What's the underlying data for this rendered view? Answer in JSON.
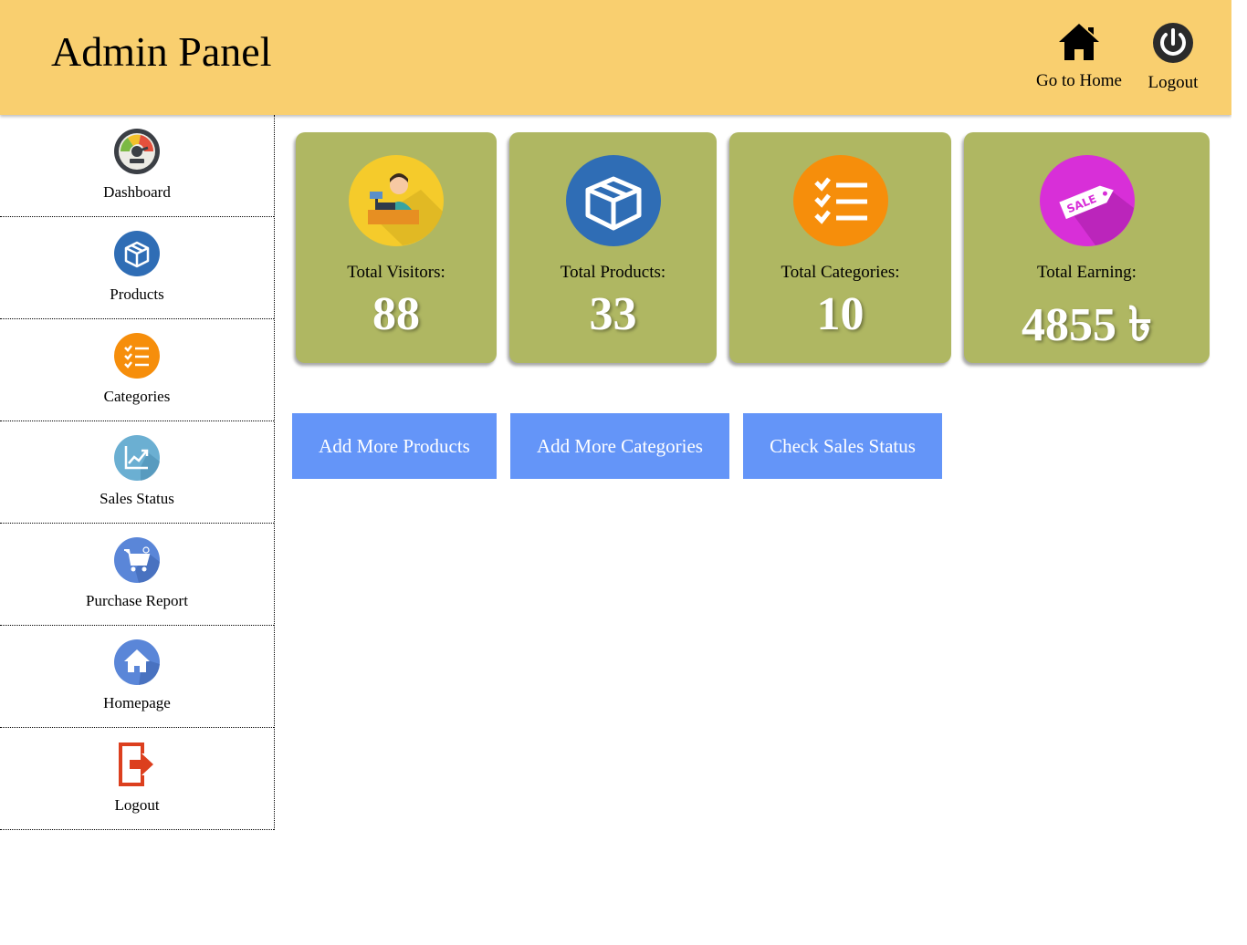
{
  "header": {
    "title": "Admin Panel",
    "home_label": "Go to Home",
    "logout_label": "Logout"
  },
  "sidebar": {
    "items": [
      {
        "label": "Dashboard",
        "icon": "speedometer-icon"
      },
      {
        "label": "Products",
        "icon": "box-icon"
      },
      {
        "label": "Categories",
        "icon": "checklist-icon"
      },
      {
        "label": "Sales Status",
        "icon": "chart-icon"
      },
      {
        "label": "Purchase Report",
        "icon": "cart-icon"
      },
      {
        "label": "Homepage",
        "icon": "home-icon"
      },
      {
        "label": "Logout",
        "icon": "exit-icon"
      }
    ]
  },
  "stats": [
    {
      "label": "Total Visitors:",
      "value": "88",
      "icon": "cashier-icon",
      "color": "#f5cb2b"
    },
    {
      "label": "Total Products:",
      "value": "33",
      "icon": "box-icon",
      "color": "#2f6db5"
    },
    {
      "label": "Total Categories:",
      "value": "10",
      "icon": "checklist-icon",
      "color": "#f68e0b"
    },
    {
      "label": "Total Earning:",
      "value": "4855 ৳",
      "icon": "sale-tag-icon",
      "color": "#d82fd8"
    }
  ],
  "actions": {
    "add_products": "Add More Products",
    "add_categories": "Add More Categories",
    "check_sales": "Check Sales Status"
  },
  "colors": {
    "header_bg": "#f9cf6f",
    "card_bg": "#afb762",
    "button_bg": "#6495f8"
  }
}
